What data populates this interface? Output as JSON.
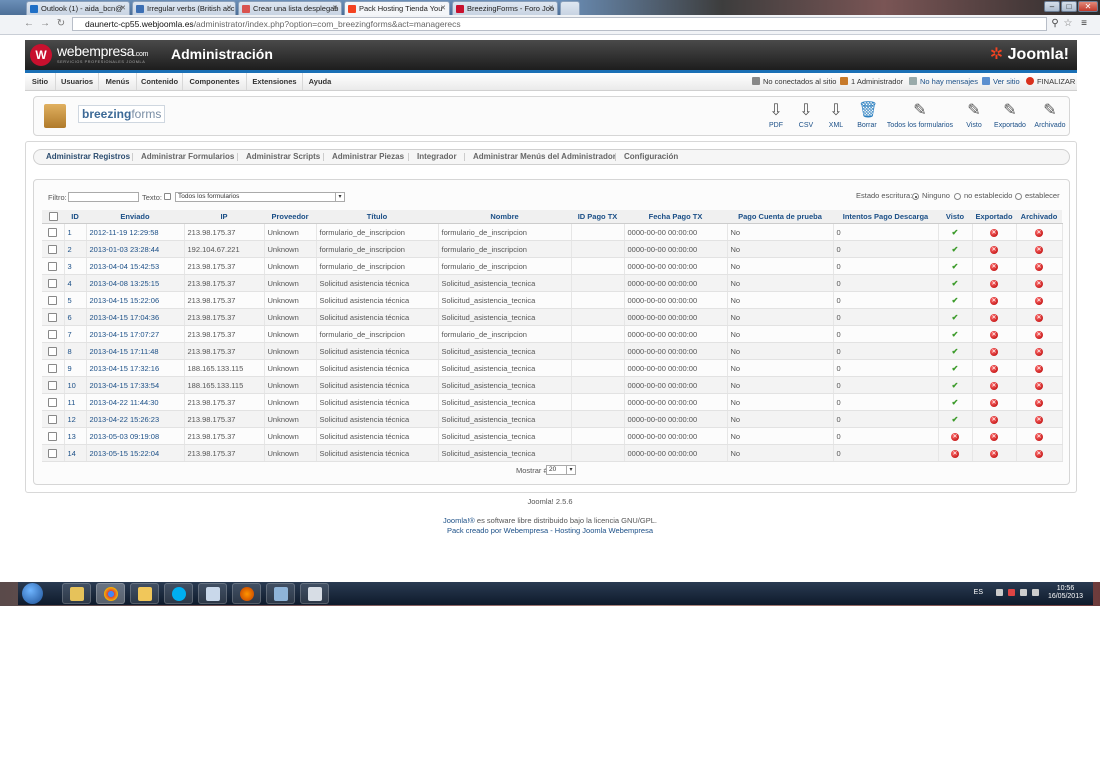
{
  "browser": {
    "tabs": [
      {
        "label": "Outlook (1) - aida_bcn@"
      },
      {
        "label": "Irregular verbs (British acc"
      },
      {
        "label": "Crear una lista desplegab"
      },
      {
        "label": "Pack Hosting Tienda You"
      },
      {
        "label": "BreezingForms - Foro Joo"
      }
    ],
    "url_domain": "daunertc-cp55.webjoomla.es",
    "url_path": "/administrator/index.php?option=com_breezingforms&act=managerecs"
  },
  "header": {
    "brand": "webempresa",
    "brand_suffix": ".com",
    "tagline": "SERVICIOS PROFESIONALES JOOMLA",
    "title": "Administración",
    "joomla_logo": "Joomla!"
  },
  "menu": {
    "items": [
      "Sitio",
      "Usuarios",
      "Menús",
      "Contenido",
      "Componentes",
      "Extensiones",
      "Ayuda"
    ],
    "status": {
      "not_connected": "No conectados al sitio",
      "admins": "1 Administrador",
      "messages": "No hay mensajes",
      "view_site": "Ver sitio",
      "logout": "FINALIZAR"
    }
  },
  "toolbar": {
    "logo_main": "breezing",
    "logo_sub": "forms",
    "buttons": [
      {
        "label": "PDF",
        "icon": "pdf-icon"
      },
      {
        "label": "CSV",
        "icon": "csv-icon"
      },
      {
        "label": "XML",
        "icon": "xml-icon"
      },
      {
        "label": "Borrar",
        "icon": "trash-icon"
      },
      {
        "label": "Todos los formularios",
        "icon": "all-forms-icon"
      },
      {
        "label": "Visto",
        "icon": "viewed-icon"
      },
      {
        "label": "Exportado",
        "icon": "exported-icon"
      },
      {
        "label": "Archivado",
        "icon": "archived-icon"
      }
    ]
  },
  "submenu": {
    "items": [
      "Administrar Registros",
      "Administrar Formularios",
      "Administrar Scripts",
      "Administrar Piezas",
      "Integrador",
      "Administrar Menús del Administrador",
      "Configuración"
    ]
  },
  "filters": {
    "filter_label": "Filtro:",
    "filter_value": "",
    "text_label": "Texto:",
    "forms_select": "Todos los formularios",
    "write_state_label": "Estado escritura:",
    "radio_none": "Ninguno",
    "radio_unset": "no establecido",
    "radio_set": "establecer"
  },
  "table": {
    "headers": [
      "ID",
      "Enviado",
      "IP",
      "Proveedor",
      "Título",
      "Nombre",
      "ID Pago TX",
      "Fecha Pago TX",
      "Pago Cuenta de prueba",
      "Intentos Pago Descarga",
      "Visto",
      "Exportado",
      "Archivado"
    ],
    "rows": [
      {
        "id": "1",
        "sent": "2012-11-19 12:29:58",
        "ip": "213.98.175.37",
        "provider": "Unknown",
        "title": "formulario_de_inscripcion",
        "name": "formulario_de_inscripcion",
        "txid": "",
        "txdate": "0000-00-00 00:00:00",
        "test": "No",
        "tries": "0",
        "viewed": true
      },
      {
        "id": "2",
        "sent": "2013-01-03 23:28:44",
        "ip": "192.104.67.221",
        "provider": "Unknown",
        "title": "formulario_de_inscripcion",
        "name": "formulario_de_inscripcion",
        "txid": "",
        "txdate": "0000-00-00 00:00:00",
        "test": "No",
        "tries": "0",
        "viewed": true
      },
      {
        "id": "3",
        "sent": "2013-04-04 15:42:53",
        "ip": "213.98.175.37",
        "provider": "Unknown",
        "title": "formulario_de_inscripcion",
        "name": "formulario_de_inscripcion",
        "txid": "",
        "txdate": "0000-00-00 00:00:00",
        "test": "No",
        "tries": "0",
        "viewed": true
      },
      {
        "id": "4",
        "sent": "2013-04-08 13:25:15",
        "ip": "213.98.175.37",
        "provider": "Unknown",
        "title": "Solicitud asistencia técnica",
        "name": "Solicitud_asistencia_tecnica",
        "txid": "",
        "txdate": "0000-00-00 00:00:00",
        "test": "No",
        "tries": "0",
        "viewed": true
      },
      {
        "id": "5",
        "sent": "2013-04-15 15:22:06",
        "ip": "213.98.175.37",
        "provider": "Unknown",
        "title": "Solicitud asistencia técnica",
        "name": "Solicitud_asistencia_tecnica",
        "txid": "",
        "txdate": "0000-00-00 00:00:00",
        "test": "No",
        "tries": "0",
        "viewed": true
      },
      {
        "id": "6",
        "sent": "2013-04-15 17:04:36",
        "ip": "213.98.175.37",
        "provider": "Unknown",
        "title": "Solicitud asistencia técnica",
        "name": "Solicitud_asistencia_tecnica",
        "txid": "",
        "txdate": "0000-00-00 00:00:00",
        "test": "No",
        "tries": "0",
        "viewed": true
      },
      {
        "id": "7",
        "sent": "2013-04-15 17:07:27",
        "ip": "213.98.175.37",
        "provider": "Unknown",
        "title": "formulario_de_inscripcion",
        "name": "formulario_de_inscripcion",
        "txid": "",
        "txdate": "0000-00-00 00:00:00",
        "test": "No",
        "tries": "0",
        "viewed": true
      },
      {
        "id": "8",
        "sent": "2013-04-15 17:11:48",
        "ip": "213.98.175.37",
        "provider": "Unknown",
        "title": "Solicitud asistencia técnica",
        "name": "Solicitud_asistencia_tecnica",
        "txid": "",
        "txdate": "0000-00-00 00:00:00",
        "test": "No",
        "tries": "0",
        "viewed": true
      },
      {
        "id": "9",
        "sent": "2013-04-15 17:32:16",
        "ip": "188.165.133.115",
        "provider": "Unknown",
        "title": "Solicitud asistencia técnica",
        "name": "Solicitud_asistencia_tecnica",
        "txid": "",
        "txdate": "0000-00-00 00:00:00",
        "test": "No",
        "tries": "0",
        "viewed": true
      },
      {
        "id": "10",
        "sent": "2013-04-15 17:33:54",
        "ip": "188.165.133.115",
        "provider": "Unknown",
        "title": "Solicitud asistencia técnica",
        "name": "Solicitud_asistencia_tecnica",
        "txid": "",
        "txdate": "0000-00-00 00:00:00",
        "test": "No",
        "tries": "0",
        "viewed": true
      },
      {
        "id": "11",
        "sent": "2013-04-22 11:44:30",
        "ip": "213.98.175.37",
        "provider": "Unknown",
        "title": "Solicitud asistencia técnica",
        "name": "Solicitud_asistencia_tecnica",
        "txid": "",
        "txdate": "0000-00-00 00:00:00",
        "test": "No",
        "tries": "0",
        "viewed": true
      },
      {
        "id": "12",
        "sent": "2013-04-22 15:26:23",
        "ip": "213.98.175.37",
        "provider": "Unknown",
        "title": "Solicitud asistencia técnica",
        "name": "Solicitud_asistencia_tecnica",
        "txid": "",
        "txdate": "0000-00-00 00:00:00",
        "test": "No",
        "tries": "0",
        "viewed": true
      },
      {
        "id": "13",
        "sent": "2013-05-03 09:19:08",
        "ip": "213.98.175.37",
        "provider": "Unknown",
        "title": "Solicitud asistencia técnica",
        "name": "Solicitud_asistencia_tecnica",
        "txid": "",
        "txdate": "0000-00-00 00:00:00",
        "test": "No",
        "tries": "0",
        "viewed": false
      },
      {
        "id": "14",
        "sent": "2013-05-15 15:22:04",
        "ip": "213.98.175.37",
        "provider": "Unknown",
        "title": "Solicitud asistencia técnica",
        "name": "Solicitud_asistencia_tecnica",
        "txid": "",
        "txdate": "0000-00-00 00:00:00",
        "test": "No",
        "tries": "0",
        "viewed": false
      }
    ]
  },
  "pagination": {
    "label": "Mostrar #",
    "value": "20"
  },
  "footer": {
    "version": "Joomla! 2.5.6",
    "license_link": "Joomla!®",
    "license_text": " es software libre distribuido bajo la licencia GNU/GPL.",
    "credit": "Pack creado por Webempresa - Hosting Joomla Webempresa"
  },
  "taskbar": {
    "lang": "ES",
    "time": "10:56",
    "date": "16/05/2013"
  },
  "colors": {
    "accent": "#1a6fb5",
    "link": "#1b4f87",
    "ok": "#3a9a28",
    "error": "#b40000"
  }
}
